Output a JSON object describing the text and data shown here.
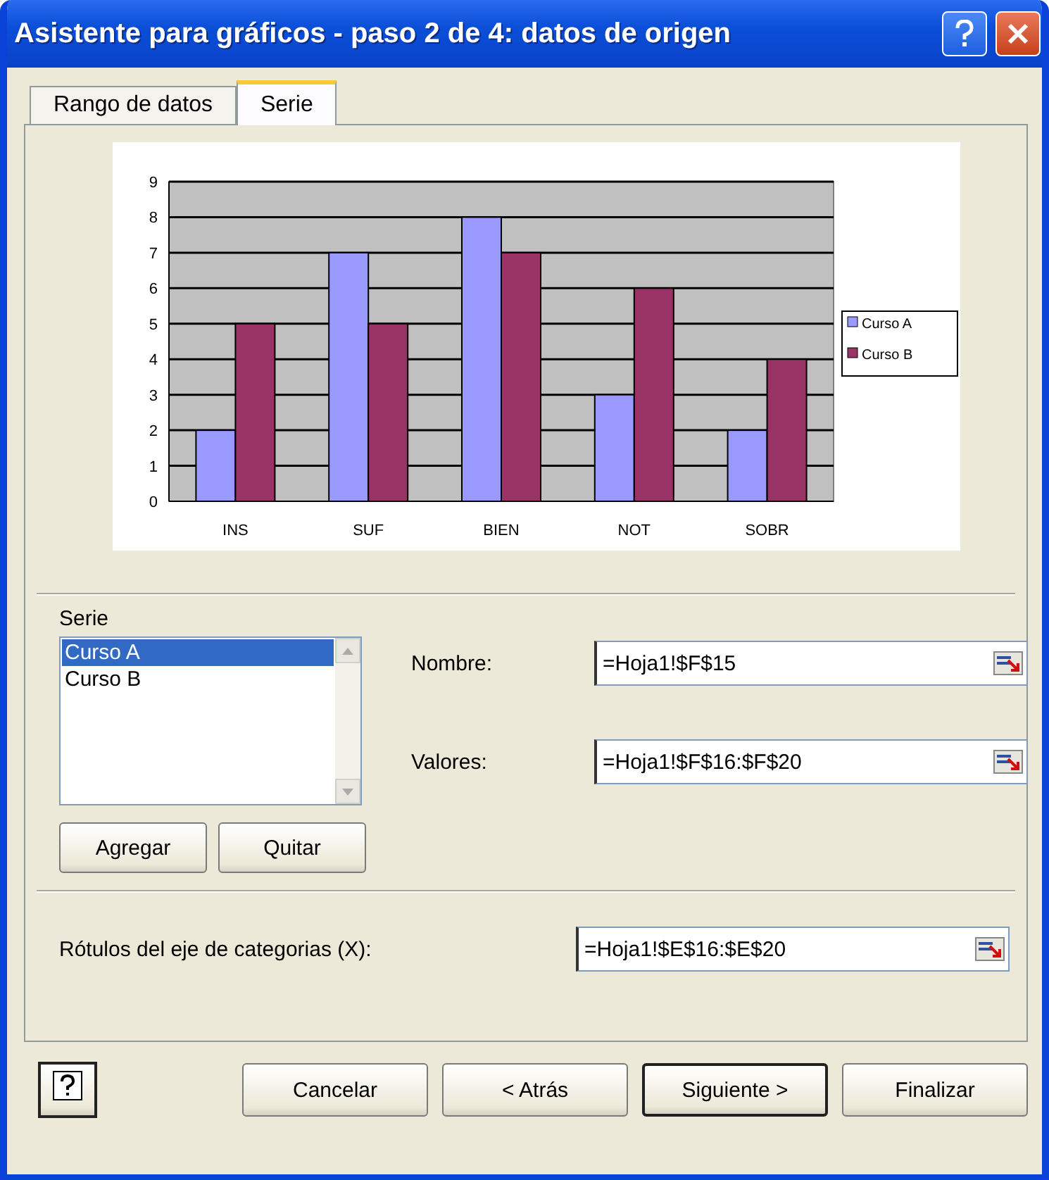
{
  "window": {
    "title": "Asistente para gráficos - paso 2 de 4: datos de origen"
  },
  "tabs": [
    {
      "label": "Rango de datos",
      "selected": false
    },
    {
      "label": "Serie",
      "selected": true
    }
  ],
  "chart_data": {
    "type": "bar",
    "grid": true,
    "legend": true,
    "categories": [
      "INS",
      "SUF",
      "BIEN",
      "NOT",
      "SOBR"
    ],
    "yticks": [
      0,
      1,
      2,
      3,
      4,
      5,
      6,
      7,
      8,
      9
    ],
    "ylim": [
      0,
      9
    ],
    "series": [
      {
        "name": "Curso A",
        "color": "#9999ff",
        "values": [
          2,
          7,
          8,
          3,
          2
        ]
      },
      {
        "name": "Curso B",
        "color": "#993366",
        "values": [
          5,
          5,
          7,
          6,
          4
        ]
      }
    ]
  },
  "series_section": {
    "label": "Serie",
    "items": [
      {
        "label": "Curso A",
        "selected": true
      },
      {
        "label": "Curso B",
        "selected": false
      }
    ],
    "buttons": [
      "Agregar",
      "Quitar"
    ]
  },
  "fields": [
    {
      "label": "Nombre:",
      "value": "=Hoja1!$F$15"
    },
    {
      "label": "Valores:",
      "value": "=Hoja1!$F$16:$F$20"
    }
  ],
  "category_field": {
    "label": "Rótulos del eje de categorias (X):",
    "value": "=Hoja1!$E$16:$E$20"
  },
  "footer_buttons": [
    {
      "label": "Cancelar",
      "default": false
    },
    {
      "label": "< Atrás",
      "default": false
    },
    {
      "label": "Siguiente >",
      "default": true
    },
    {
      "label": "Finalizar",
      "default": false
    }
  ]
}
